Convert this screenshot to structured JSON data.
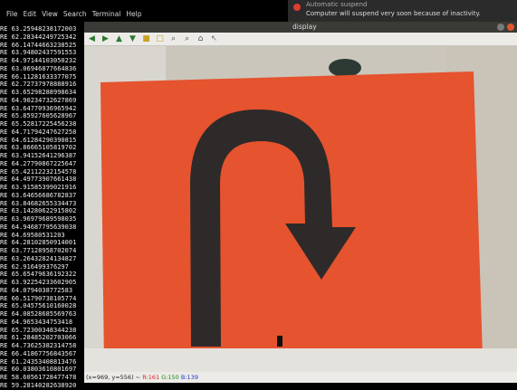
{
  "menubar": {
    "items": [
      "File",
      "Edit",
      "View",
      "Search",
      "Terminal",
      "Help"
    ]
  },
  "notification": {
    "title": "Automatic suspend",
    "message": "Computer will suspend very soon because of inactivity."
  },
  "terminal_lines": [
    "RE 63.25948238172003",
    "RE 62.28344249725342",
    "RE 66.14744663238525",
    "RE 63.94802437591553",
    "RE 64.97144103050232",
    "RE 63.06946877664836",
    "RE 66.11281633377075",
    "RE 62.72737978888916",
    "RE 63.65298288998634",
    "RE 64.90234732627869",
    "RE 63.64770936965942",
    "RE 65.85927605628967",
    "RE 65.52817225456238",
    "RE 64.71794247627258",
    "RE 64.61284290390815",
    "RE 63.86665105819702",
    "RE 63.94152641296387",
    "RE 64.27790867225647",
    "RE 65.42112232154578",
    "RE 64.49773907661438",
    "RE 63.91585399021916",
    "RE 63.64656686782837",
    "RE 63.84682655334473",
    "RE 63.14280622915802",
    "RE 63.96979689598035",
    "RE 64.94687795639038",
    "RE 64.69580531203",
    "RE 64.28102850914001",
    "RE 63.77128958702074",
    "RE 63.26432824134827",
    "RE 62.916499376297",
    "RE 65.65479636192322",
    "RE 63.92254233602905",
    "RE 64.0794038772583",
    "RE 66.51790738105774",
    "RE 65.04575610160028",
    "RE 64.08528685569763",
    "RE 64.9653434753418",
    "RE 65.72300348344238",
    "RE 61.28485202703066",
    "RE 64.73625382314758",
    "RE 66.41867756843567",
    "RE 61.24353408813476",
    "RE 60.03803610801697",
    "RE 58.60561728477478",
    "RE 59.28140282638920"
  ],
  "display_window": {
    "title": "display",
    "toolbar": [
      "arrow-left",
      "arrow-right",
      "arrow-up",
      "arrow-down",
      "save",
      "zoom-fit",
      "zoom-in",
      "zoom-out",
      "zoom-reset",
      "pointer"
    ],
    "status": {
      "coords": "(x=969, y=556) ~ ",
      "r": "R:161",
      "g": "G:150",
      "b": "B:139"
    }
  },
  "colors": {
    "sign_red": "#e5532f",
    "arrow": "#2e2a29",
    "bg": "#d8d4cc"
  }
}
